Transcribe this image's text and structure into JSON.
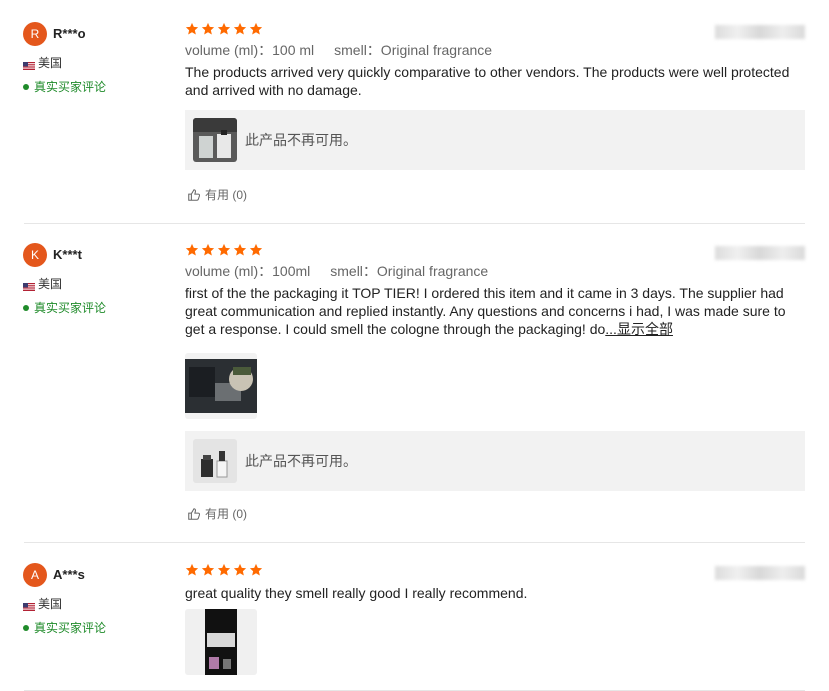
{
  "reviews": [
    {
      "avatar_letter": "R",
      "name": "R***o",
      "country": "美国",
      "verified": "真实买家评论",
      "attr_volume": "volume (ml)：100 ml",
      "attr_smell": "smell：Original fragrance",
      "text": "The products arrived very quickly comparative to other vendors. The products were well protected and arrived with no damage.",
      "product_unavailable": "此产品不再可用。",
      "helpful": "有用 (0)"
    },
    {
      "avatar_letter": "K",
      "name": "K***t",
      "country": "美国",
      "verified": "真实买家评论",
      "attr_volume": "volume (ml)：100ml",
      "attr_smell": "smell：Original fragrance",
      "text": "first of the the packaging it TOP TIER! I ordered this item and it came in 3 days. The supplier had great communication and replied instantly. Any questions and concerns i had, I was made sure to get a response. I could smell the cologne through the packaging! do",
      "more": "...显示全部",
      "product_unavailable": "此产品不再可用。",
      "helpful": "有用 (0)"
    },
    {
      "avatar_letter": "A",
      "name": "A***s",
      "country": "美国",
      "verified": "真实买家评论",
      "text": "great quality they smell really good I really recommend."
    }
  ],
  "rating_stars": 5,
  "colors": {
    "star": "#ff6a00",
    "avatar": "#e4571c",
    "verified": "#1f8b2a",
    "product_bg": "#f2f2f2"
  },
  "icons": {
    "star": "star-icon",
    "thumb": "thumbs-up-icon",
    "flag": "us-flag-icon"
  }
}
